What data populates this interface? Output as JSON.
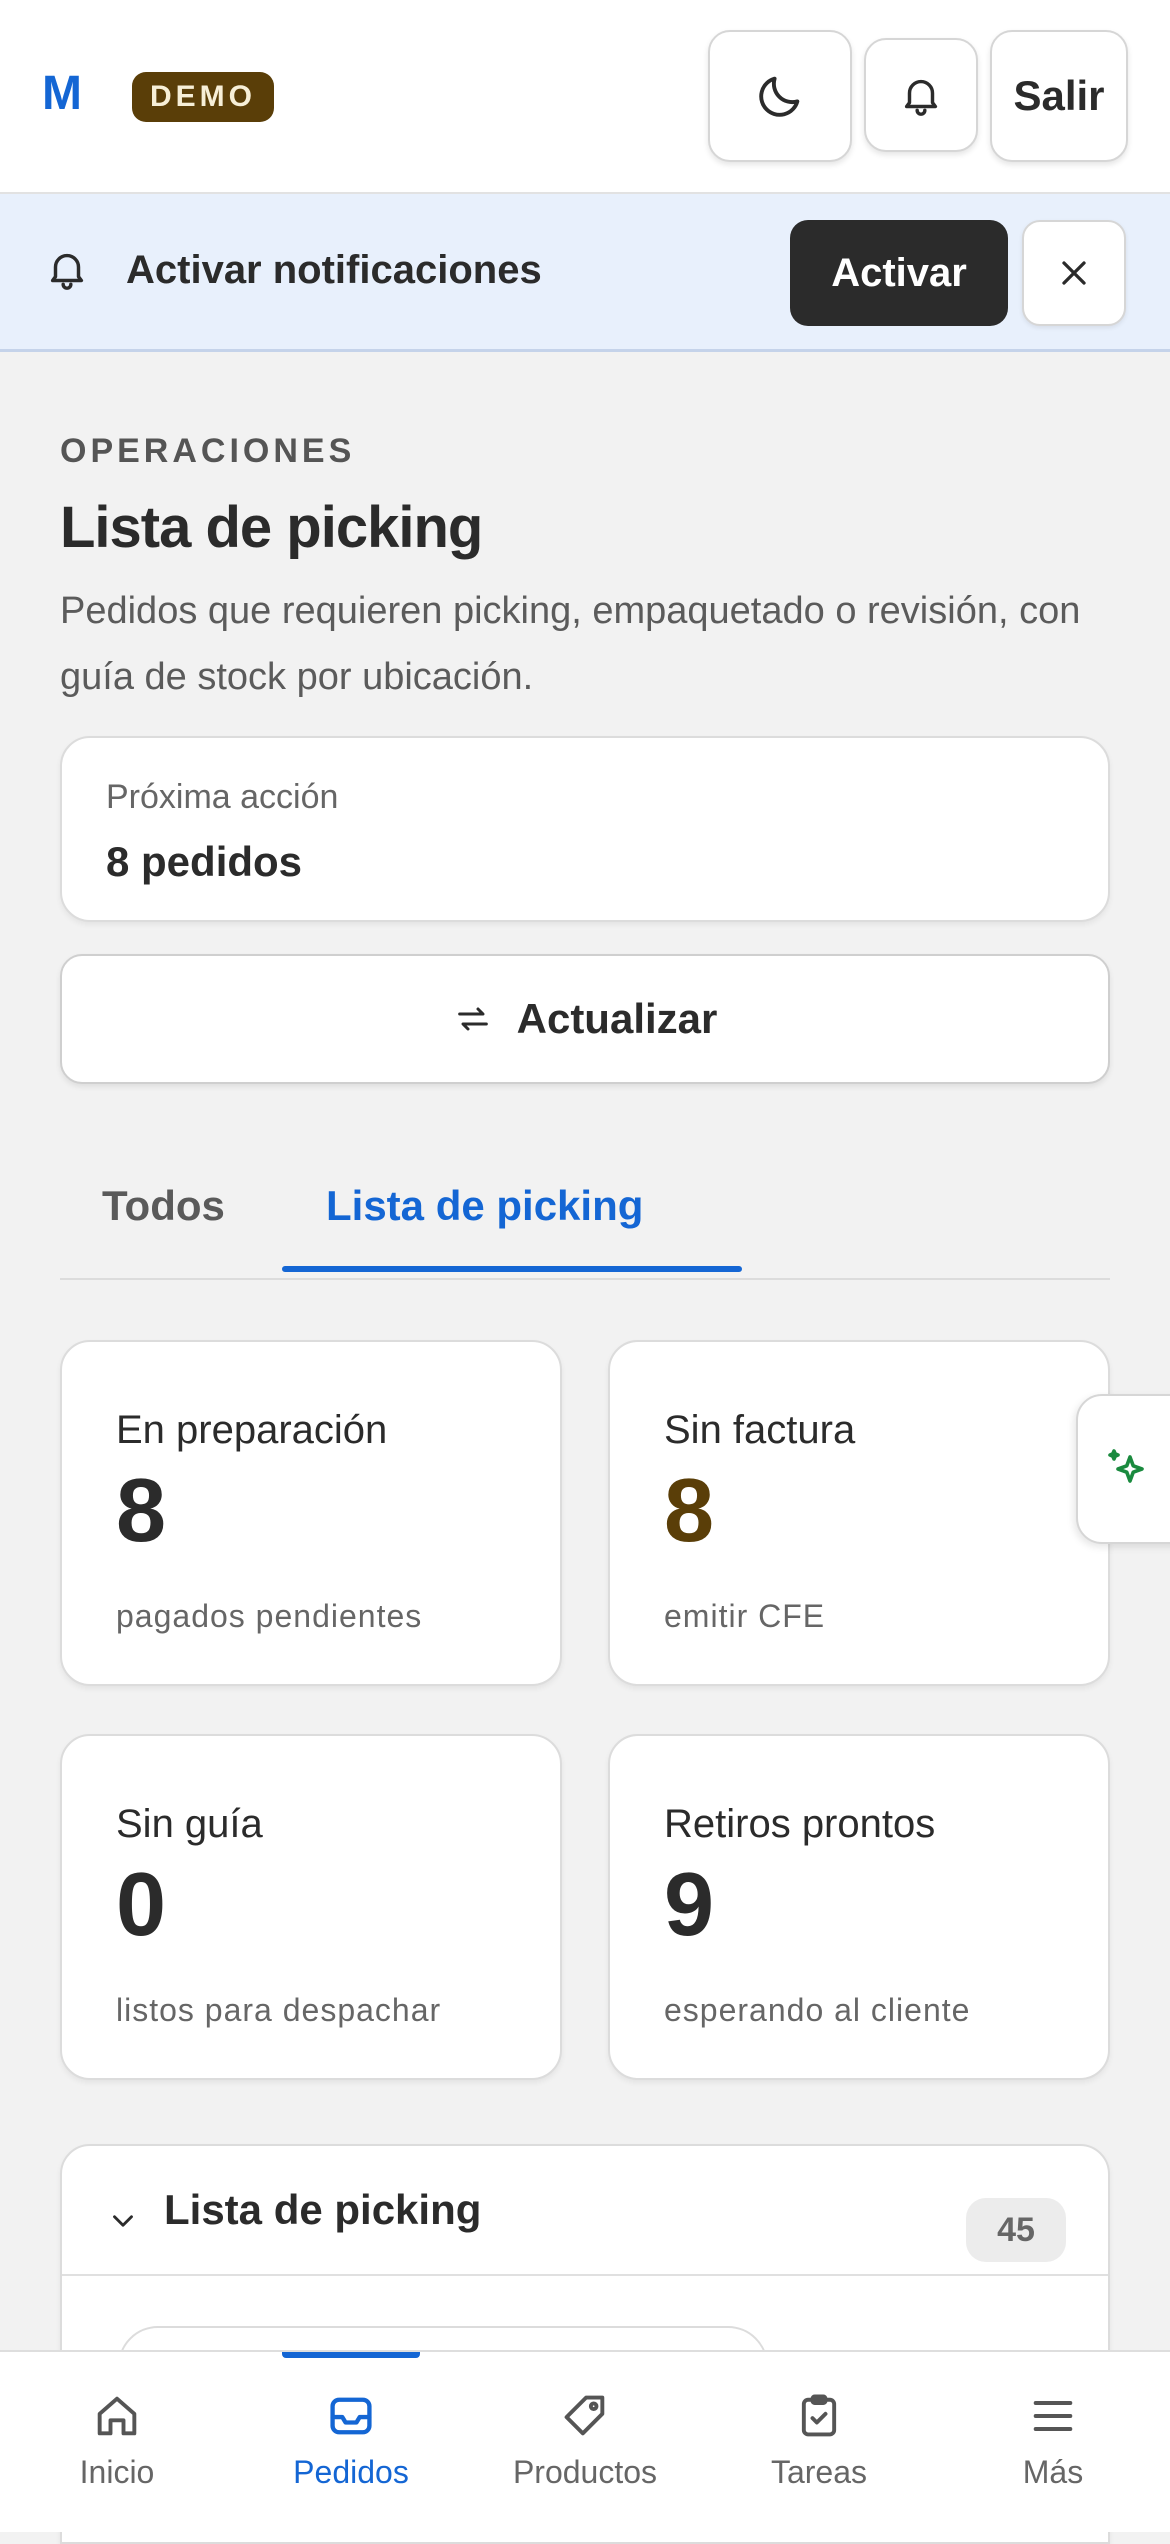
{
  "header": {
    "logo": "M",
    "badge": "DEMO",
    "theme_icon": "moon-icon",
    "notifications_icon": "bell-icon",
    "exit_label": "Salir"
  },
  "notification_banner": {
    "icon": "bell-icon",
    "text": "Activar notificaciones",
    "activate_label": "Activar",
    "close_icon": "close-icon"
  },
  "page": {
    "eyebrow": "OPERACIONES",
    "title": "Lista de picking",
    "description": "Pedidos que requieren picking, empaquetado o revisión, con guía de stock por ubicación."
  },
  "next_action": {
    "label": "Próxima acción",
    "value": "8 pedidos"
  },
  "refresh": {
    "icon": "refresh-icon",
    "label": "Actualizar"
  },
  "tabs": [
    {
      "label": "Todos",
      "active": false
    },
    {
      "label": "Lista de picking",
      "active": true
    }
  ],
  "stats": [
    {
      "label": "En preparación",
      "value": "8",
      "sub": "pagados pendientes",
      "color": "#2b2b2b"
    },
    {
      "label": "Sin factura",
      "value": "8",
      "sub": "emitir CFE",
      "color": "#5a3e08"
    },
    {
      "label": "Sin guía",
      "value": "0",
      "sub": "listos para despachar",
      "color": "#2b2b2b"
    },
    {
      "label": "Retiros prontos",
      "value": "9",
      "sub": "esperando al cliente",
      "color": "#2b2b2b"
    }
  ],
  "picking_panel": {
    "chevron_icon": "chevron-down-icon",
    "title": "Lista de picking",
    "count": "45"
  },
  "assistant_icon": "sparkles-icon",
  "bottom_nav": [
    {
      "label": "Inicio",
      "icon": "home-icon",
      "active": false
    },
    {
      "label": "Pedidos",
      "icon": "inbox-icon",
      "active": true
    },
    {
      "label": "Productos",
      "icon": "tag-icon",
      "active": false
    },
    {
      "label": "Tareas",
      "icon": "clipboard-check-icon",
      "active": false
    },
    {
      "label": "Más",
      "icon": "menu-icon",
      "active": false
    }
  ],
  "colors": {
    "accent": "#1466d4",
    "demo_badge": "#5a3e08",
    "banner_bg": "#e8f0fc",
    "page_bg": "#f2f2f2"
  }
}
